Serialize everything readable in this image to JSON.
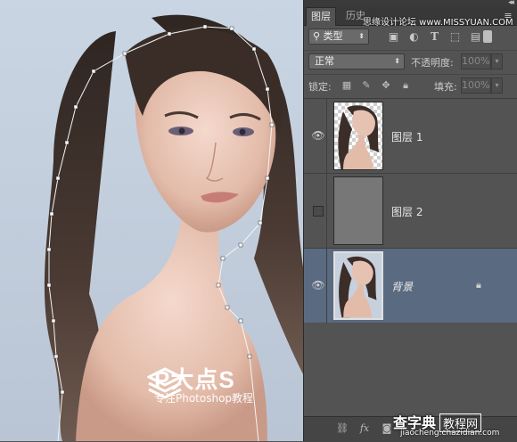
{
  "panel": {
    "tabs": [
      {
        "label": "图层"
      },
      {
        "label": "历史"
      }
    ],
    "top_watermark": "思缘设计论坛 www.MISSYUAN.COM",
    "filter": {
      "label": "类型"
    },
    "filter_icons": [
      "image-icon",
      "adjustment-icon",
      "text-icon",
      "shape-icon",
      "smart-object-icon"
    ],
    "blend_mode": "正常",
    "opacity_label": "不透明度:",
    "opacity_value": "100%",
    "lock_label": "锁定:",
    "fill_label": "填充:",
    "fill_value": "100%",
    "layers": [
      {
        "name": "图层 1",
        "visible": true,
        "selected": false
      },
      {
        "name": "图层 2",
        "visible": false,
        "selected": false
      },
      {
        "name": "背景",
        "visible": true,
        "selected": true,
        "locked": true
      }
    ],
    "bottom_icons": [
      "link-icon",
      "fx-icon",
      "mask-icon",
      "adjustment-layer-icon",
      "group-icon",
      "new-layer-icon",
      "trash-icon"
    ]
  },
  "canvas": {
    "watermark_title": "P大点S",
    "watermark_subtitle": "专注Photoshop教程"
  },
  "site_watermark": {
    "name": "查字典",
    "box": "教程网",
    "url": "jiaocheng.chazidian.com"
  },
  "colors": {
    "selected_layer": "#5a6a80",
    "panel_bg": "#535353"
  }
}
